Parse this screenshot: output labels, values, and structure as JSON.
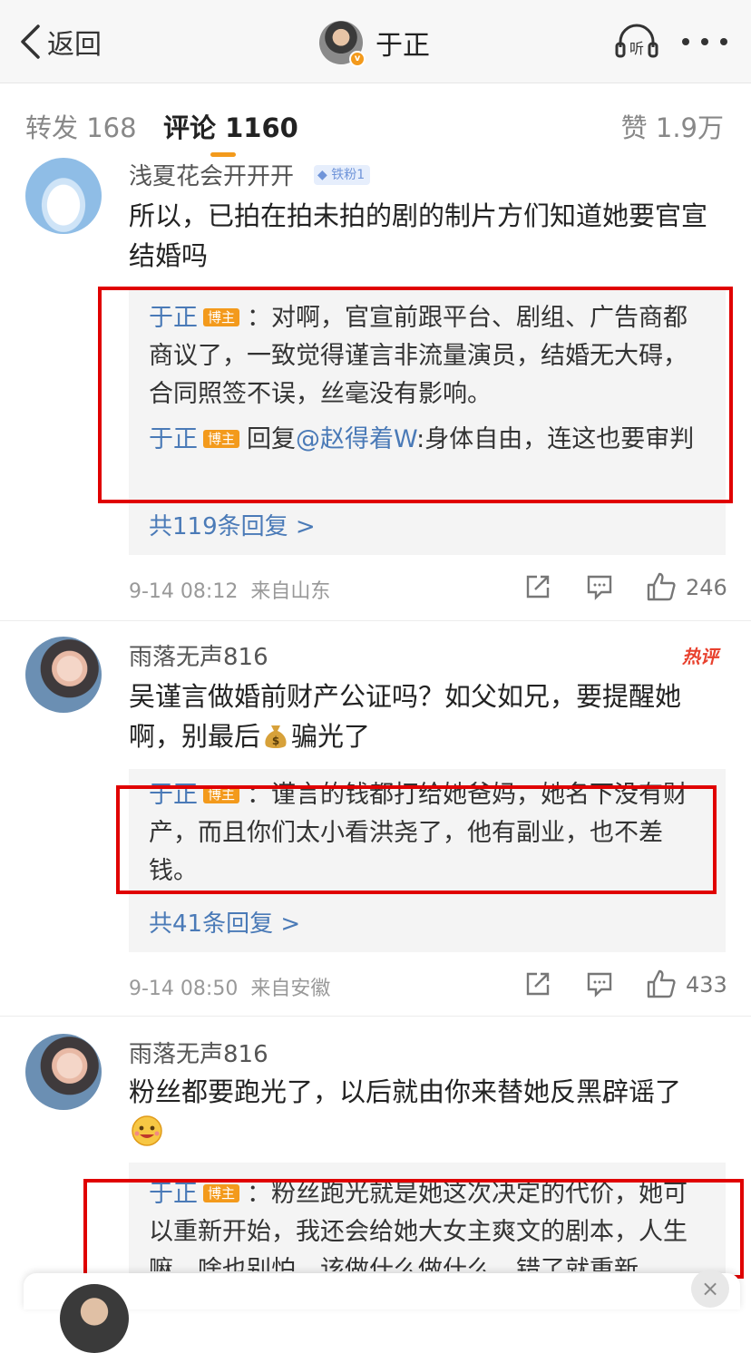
{
  "nav": {
    "back_label": "返回",
    "title": "于正",
    "listen_label": "听"
  },
  "tabs": {
    "repost": "转发 168",
    "comments": "评论 1160",
    "likes": "赞 1.9万"
  },
  "comments": [
    {
      "user": "浅夏花会开开开",
      "fan_badge": "铁粉1",
      "text": "所以，已拍在拍未拍的剧的制片方们知道她要官宣结婚吗",
      "replies": [
        {
          "name": "于正",
          "badge": "博主",
          "text": "：对啊，官宣前跟平台、剧组、广告商都商议了，一致觉得谨言非流量演员，结婚无大碍，合同照签不误，丝毫没有影响。"
        },
        {
          "name": "于正",
          "badge": "博主",
          "prefix": "回复",
          "mention": "@赵得着W",
          "text": ":身体自由，连这也要审判"
        }
      ],
      "more_replies": "共119条回复 >",
      "time": "9-14 08:12",
      "location": "来自山东",
      "likes": "246"
    },
    {
      "user": "雨落无声816",
      "hot_badge": "热评",
      "text_a": "吴谨言做婚前财产公证吗？如父如兄，要提醒她啊，别最后",
      "text_b": "骗光了",
      "replies": [
        {
          "name": "于正",
          "badge": "博主",
          "text": "：谨言的钱都打给她爸妈，她名下没有财产，而且你们太小看洪尧了，他有副业，也不差钱。"
        }
      ],
      "more_replies": "共41条回复 >",
      "time": "9-14 08:50",
      "location": "来自安徽",
      "likes": "433"
    },
    {
      "user": "雨落无声816",
      "text": "粉丝都要跑光了，以后就由你来替她反黑辟谣了",
      "replies": [
        {
          "name": "于正",
          "badge": "博主",
          "text": "：粉丝跑光就是她这次决定的代价，她可以重新开始，我还会给她大女主爽文的剧本，人生嘛，啥也别怕，该做什么做什么，错了就重新"
        }
      ]
    }
  ],
  "colors": {
    "accent": "#f39a1c",
    "link": "#4a7ab7",
    "highlight": "#e00000",
    "hot": "#e8412e"
  },
  "icons": [
    "back-chevron-icon",
    "listen-icon",
    "more-dots-icon",
    "share-icon",
    "comment-icon",
    "like-icon",
    "money-bag-icon",
    "smile-emoji-icon",
    "close-icon"
  ]
}
